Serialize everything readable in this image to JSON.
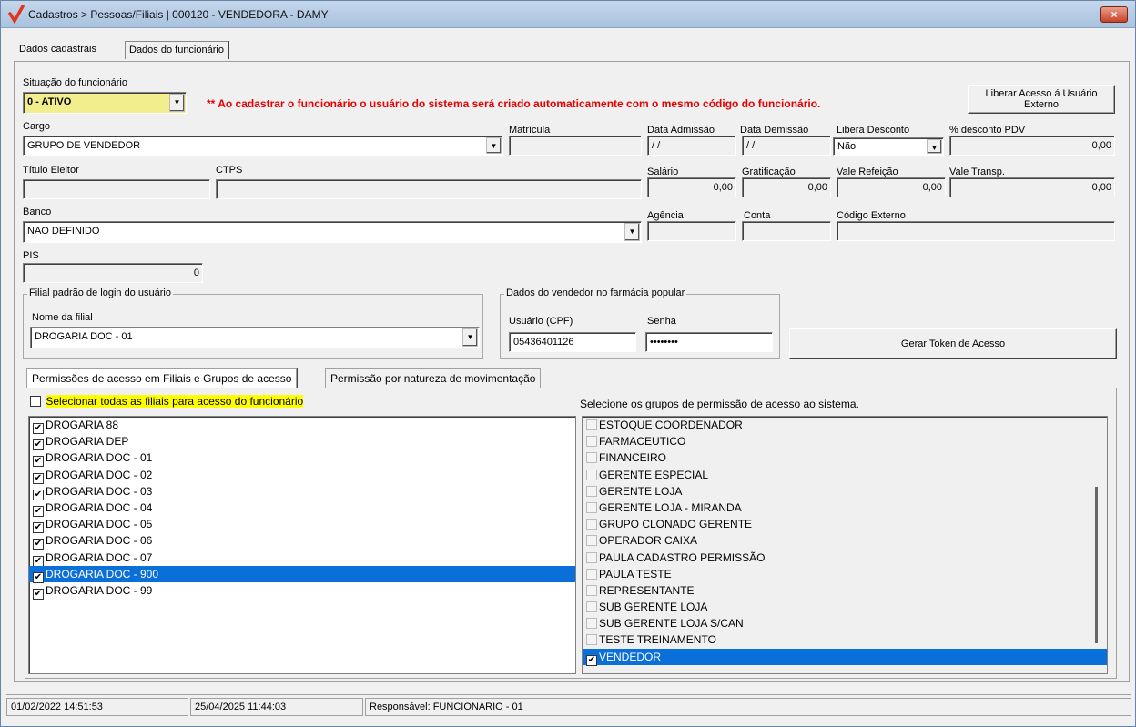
{
  "window": {
    "title": "Cadastros > Pessoas/Filiais | 000120 - VENDEDORA - DAMY",
    "close_label": "×"
  },
  "top_tabs": [
    "Dados cadastrais",
    "Dados do funcionário"
  ],
  "form": {
    "situacao_label": "Situação do funcionário",
    "situacao_value": "0 - ATIVO",
    "note": "** Ao cadastrar o funcionário o usuário do sistema será criado automaticamente com o mesmo código do funcionário.",
    "liberar_button": "Liberar Acesso á Usuário Externo",
    "cargo_label": "Cargo",
    "cargo_value": "GRUPO DE VENDEDOR",
    "matricula_label": "Matrícula",
    "matricula_value": "",
    "data_admissao_label": "Data Admissão",
    "data_admissao_value": " / /",
    "data_demissao_label": "Data Demissão",
    "data_demissao_value": " / /",
    "libera_desconto_label": "Libera Desconto",
    "libera_desconto_value": "Não",
    "desconto_pdv_label": "% desconto PDV",
    "desconto_pdv_value": "0,00",
    "titulo_eleitor_label": "Título Eleitor",
    "titulo_eleitor_value": "",
    "ctps_label": "CTPS",
    "ctps_value": "",
    "salario_label": "Salário",
    "salario_value": "0,00",
    "gratificacao_label": "Gratificação",
    "gratificacao_value": "0,00",
    "vale_refeicao_label": "Vale Refeição",
    "vale_refeicao_value": "0,00",
    "vale_transp_label": "Vale Transp.",
    "vale_transp_value": "0,00",
    "banco_label": "Banco",
    "banco_value": "NAO DEFINIDO",
    "agencia_label": "Agência",
    "agencia_value": "",
    "conta_label": "Conta",
    "conta_value": "",
    "codigo_externo_label": "Código Externo",
    "codigo_externo_value": "",
    "pis_label": "PIS",
    "pis_value": "0",
    "filial_group_title": "Filial padrão de login do usuário",
    "nome_filial_label": "Nome da filial",
    "nome_filial_value": "DROGARIA DOC - 01",
    "vendedor_group_title": "Dados do vendedor no farmácia popular",
    "usuario_cpf_label": "Usuário (CPF)",
    "usuario_cpf_value": "05436401126",
    "senha_label": "Senha",
    "senha_value": "••••••••",
    "gerar_token_button": "Gerar Token de Acesso"
  },
  "lower_tabs": [
    "Permissões de acesso em Filiais e Grupos de acesso",
    "Permissão por natureza de movimentação"
  ],
  "select_all_label": "Selecionar todas as filiais para acesso do funcionário",
  "filiais": [
    {
      "name": "DROGARIA 88",
      "checked": true
    },
    {
      "name": "DROGARIA DEP",
      "checked": true
    },
    {
      "name": "DROGARIA DOC - 01",
      "checked": true
    },
    {
      "name": "DROGARIA DOC - 02",
      "checked": true
    },
    {
      "name": "DROGARIA DOC - 03",
      "checked": true
    },
    {
      "name": "DROGARIA DOC - 04",
      "checked": true
    },
    {
      "name": "DROGARIA DOC - 05",
      "checked": true
    },
    {
      "name": "DROGARIA DOC - 06",
      "checked": true
    },
    {
      "name": "DROGARIA DOC - 07",
      "checked": true
    },
    {
      "name": "DROGARIA DOC - 900",
      "checked": true,
      "selected": true
    },
    {
      "name": "DROGARIA DOC - 99",
      "checked": true
    }
  ],
  "groups_header": "Selecione os grupos de permissão de acesso ao sistema.",
  "groups": [
    {
      "name": "ESTOQUE COORDENADOR",
      "checked": false
    },
    {
      "name": "FARMACEUTICO",
      "checked": false
    },
    {
      "name": "FINANCEIRO",
      "checked": false
    },
    {
      "name": "GERENTE ESPECIAL",
      "checked": false
    },
    {
      "name": "GERENTE LOJA",
      "checked": false
    },
    {
      "name": "GERENTE LOJA - MIRANDA",
      "checked": false
    },
    {
      "name": "GRUPO CLONADO GERENTE",
      "checked": false
    },
    {
      "name": "OPERADOR CAIXA",
      "checked": false
    },
    {
      "name": "PAULA CADASTRO PERMISSÃO",
      "checked": false
    },
    {
      "name": "PAULA TESTE",
      "checked": false
    },
    {
      "name": "REPRESENTANTE",
      "checked": false
    },
    {
      "name": "SUB GERENTE LOJA",
      "checked": false
    },
    {
      "name": "SUB GERENTE LOJA S/CAN",
      "checked": false
    },
    {
      "name": "TESTE TREINAMENTO",
      "checked": false
    },
    {
      "name": "VENDEDOR",
      "checked": true,
      "selected": true
    }
  ],
  "status": {
    "created": "01/02/2022 14:51:53",
    "updated": "25/04/2025 11:44:03",
    "responsavel": "Responsável: FUNCIONARIO - 01"
  },
  "colors": {
    "selection": "#0a6fd8",
    "note_red": "#e60000",
    "status_yellow": "#f3ee8d"
  }
}
